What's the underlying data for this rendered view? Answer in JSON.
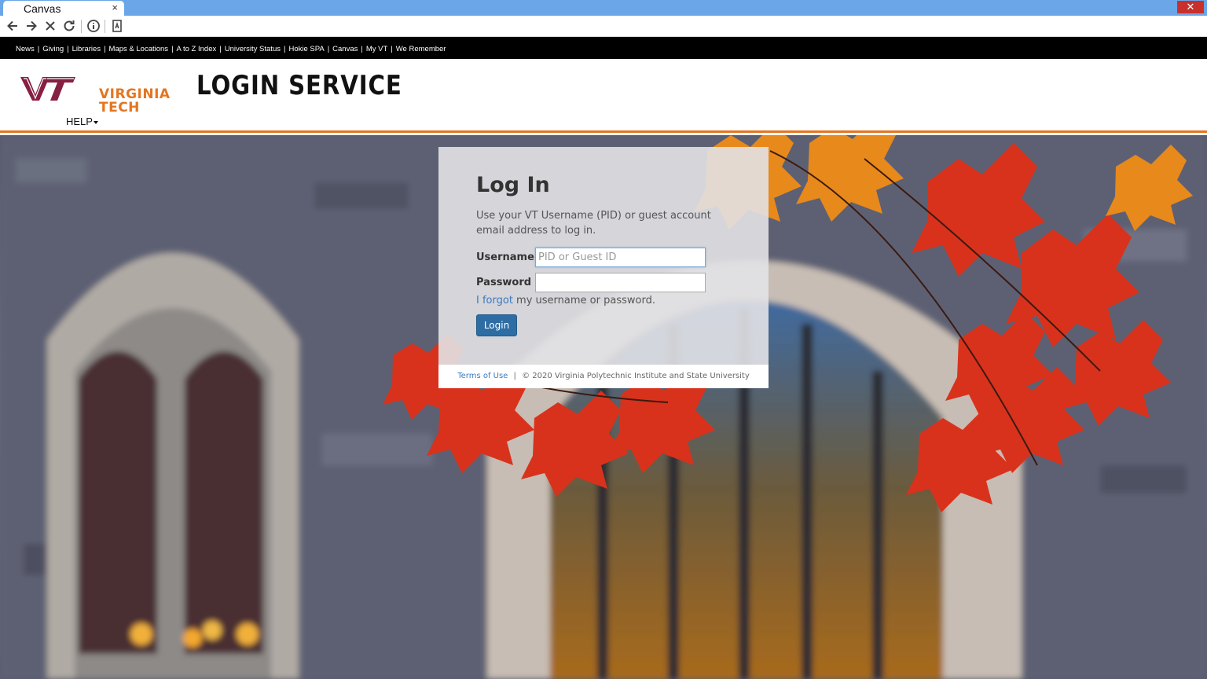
{
  "browser": {
    "tab_title": "Canvas",
    "tab_close": "×",
    "window_close": "✕"
  },
  "utility_links": [
    "News",
    "Giving",
    "Libraries",
    "Maps & Locations",
    "A to Z Index",
    "University Status",
    "Hokie SPA",
    "Canvas",
    "My VT",
    "We Remember"
  ],
  "header": {
    "logo_line1": "VIRGINIA",
    "logo_line2": "TECH",
    "service_title": "LOGIN SERVICE",
    "help_label": "HELP"
  },
  "login": {
    "title": "Log In",
    "intro": "Use your VT Username (PID) or guest account email address to log in.",
    "username_label": "Username",
    "username_placeholder": "PID or Guest ID",
    "username_value": "",
    "password_label": "Password",
    "password_value": "",
    "forgot_link": "I forgot",
    "forgot_rest": " my username or password.",
    "login_button": "Login"
  },
  "footer": {
    "terms": "Terms of Use",
    "separator": "|",
    "copyright": "© 2020 Virginia Polytechnic Institute and State University"
  },
  "colors": {
    "vt_orange": "#e5751f",
    "vt_maroon": "#861f41",
    "link_blue": "#3a7bbf",
    "button_blue": "#2e6da4",
    "titlebar_blue": "#6aa6e8"
  }
}
